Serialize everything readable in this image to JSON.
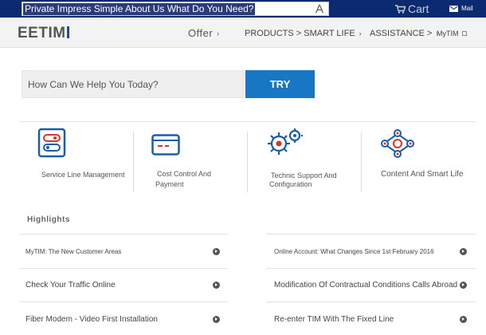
{
  "topbar": {
    "search_text": "Private Impress Simple About Us What Do You Need?",
    "search_letter": "A",
    "cart_label": "Cart",
    "mail_label": "Mail"
  },
  "header": {
    "logo": "EETIM",
    "nav": {
      "offer": "Offer",
      "products": "PRODUCTS > SMART LIFE",
      "assistance": "ASSISTANCE >",
      "mytim": "MyTIM"
    }
  },
  "help": {
    "placeholder": "How Can We Help You Today?",
    "button": "TRY"
  },
  "categories": [
    {
      "label": "Service Line Management",
      "icon": "sliders-icon"
    },
    {
      "label": "Cost Control And",
      "label2": "Payment",
      "icon": "credit-card-icon"
    },
    {
      "label": "Technic Support And",
      "label2": "Configuration",
      "icon": "gears-icon"
    },
    {
      "label": "Content And Smart Life",
      "icon": "network-icon"
    }
  ],
  "highlights_title": "Highlights",
  "highlights": {
    "left": [
      "MyTIM: The New Customer Areas",
      "Check Your Traffic Online",
      "Fiber Modem - Video First Installation"
    ],
    "right": [
      "Online Account: What Changes Since 1st February 2016",
      "Modification Of Contractual Conditions Calls Abroad",
      "Re-enter TIM With The Fixed Line"
    ]
  },
  "colors": {
    "topbar": "#0b2a6f",
    "accent": "#1777c4",
    "icon_blue": "#1a5ea8",
    "icon_red": "#d8342d"
  }
}
